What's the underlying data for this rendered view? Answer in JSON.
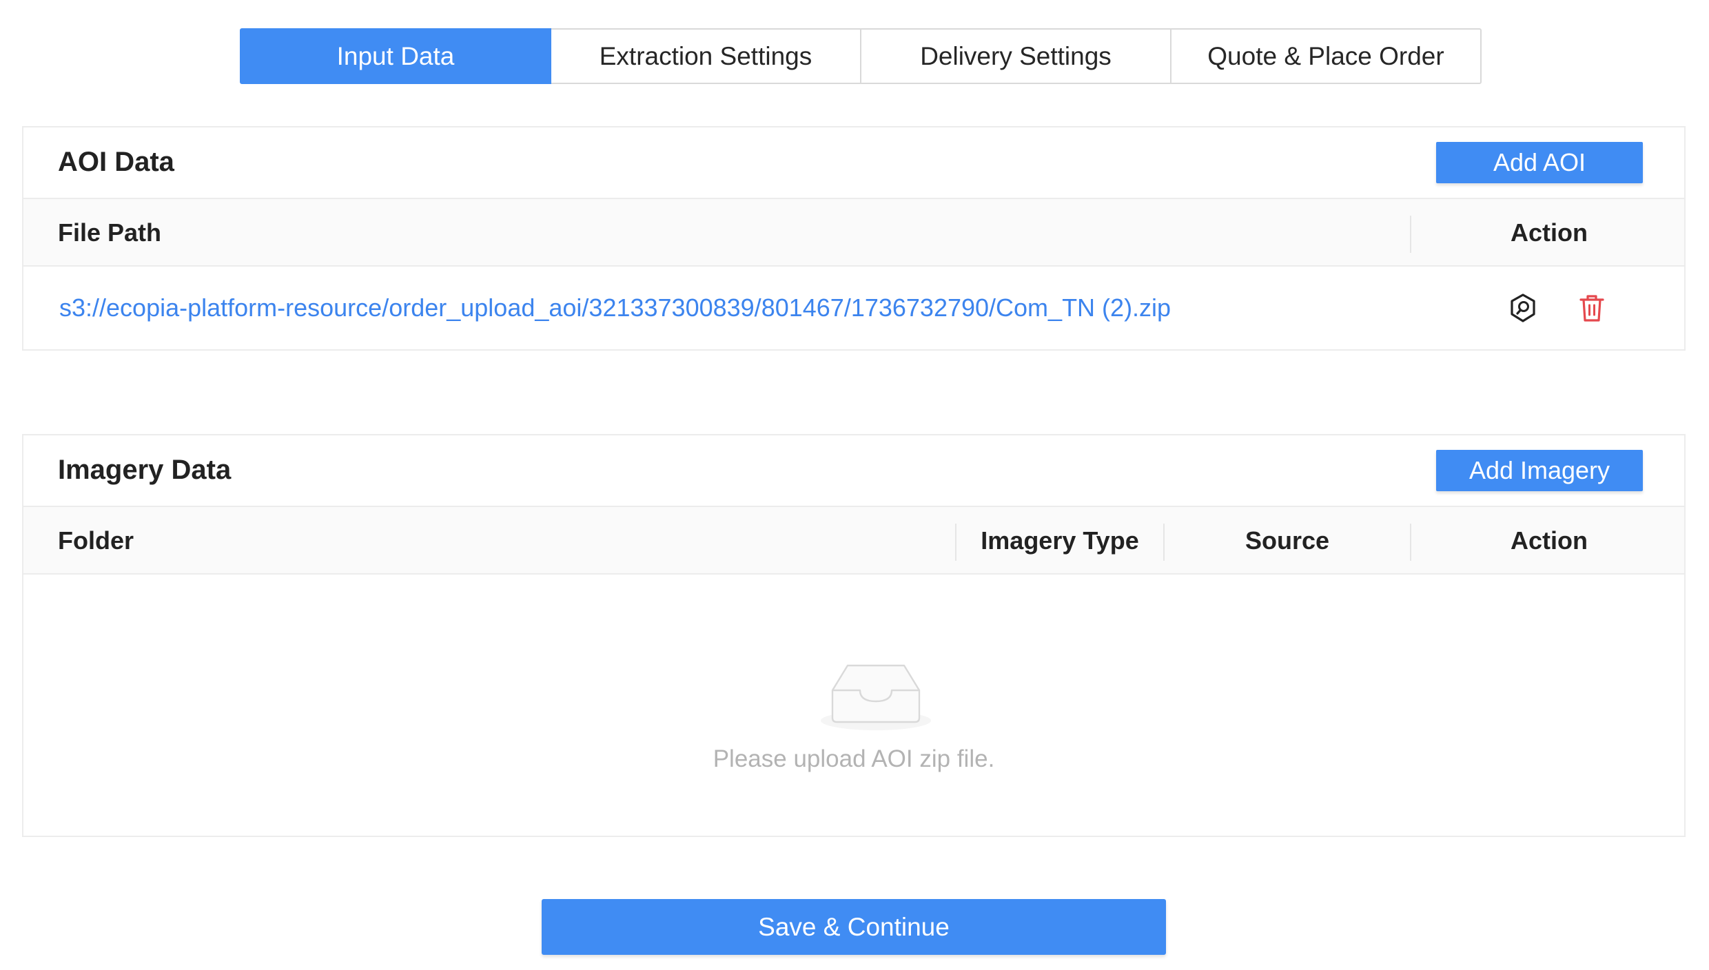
{
  "steps": [
    {
      "label": "Input Data",
      "active": true
    },
    {
      "label": "Extraction Settings",
      "active": false
    },
    {
      "label": "Delivery Settings",
      "active": false
    },
    {
      "label": "Quote & Place Order",
      "active": false
    }
  ],
  "aoi": {
    "title": "AOI Data",
    "add_label": "Add AOI",
    "columns": [
      "File Path",
      "Action"
    ],
    "rows": [
      {
        "file_path": "s3://ecopia-platform-resource/order_upload_aoi/321337300839/801467/1736732790/Com_TN (2).zip",
        "actions": [
          "shield-search-icon",
          "trash-icon"
        ]
      }
    ]
  },
  "imagery": {
    "title": "Imagery Data",
    "add_label": "Add Imagery",
    "columns": [
      "Folder",
      "Imagery Type",
      "Source",
      "Action"
    ],
    "empty_text": "Please upload AOI zip file.",
    "empty_icon": "empty-inbox-icon"
  },
  "footer": {
    "save_label": "Save & Continue"
  },
  "colors": {
    "primary": "#408cf3",
    "link": "#3c84ee",
    "danger": "#e5484d",
    "border": "#ececec",
    "header_bg": "#fafafa"
  }
}
